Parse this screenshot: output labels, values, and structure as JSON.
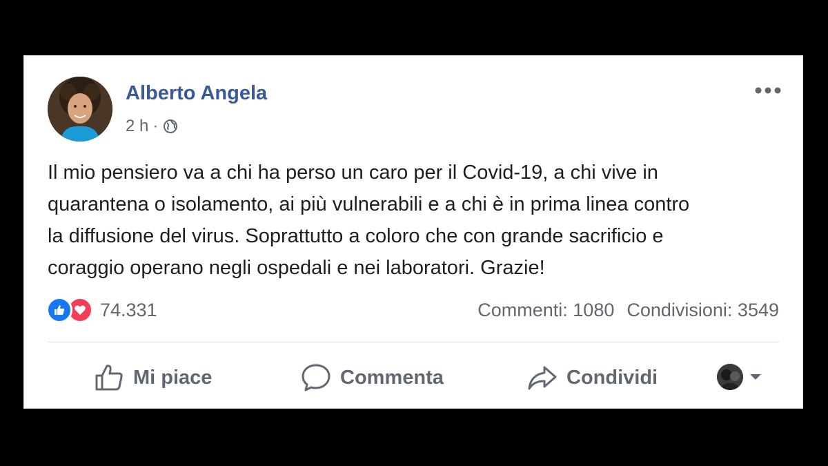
{
  "post": {
    "author": "Alberto Angela",
    "time": "2 h",
    "separator": "·",
    "icons": {
      "audience": "globe-icon",
      "menu": "more-options-icon"
    },
    "text": "Il mio pensiero va a chi ha perso un caro per il Covid-19, a chi vive in\nquarantena o isolamento, ai più vulnerabili e a chi è in prima linea contro\nla diffusione del virus. Soprattutto a coloro che con grande sacrificio e\ncoraggio operano negli ospedali e nei laboratori. Grazie!"
  },
  "reactions": {
    "types": [
      "like",
      "love"
    ],
    "count": "74.331"
  },
  "stats": {
    "comments": "Commenti: 1080",
    "shares": "Condivisioni: 3549"
  },
  "actions": {
    "like": "Mi piace",
    "comment": "Commenta",
    "share": "Condividi"
  },
  "colors": {
    "author": "#385898",
    "like": "#1877f2",
    "love": "#f33e58",
    "secondary_text": "#606770"
  }
}
